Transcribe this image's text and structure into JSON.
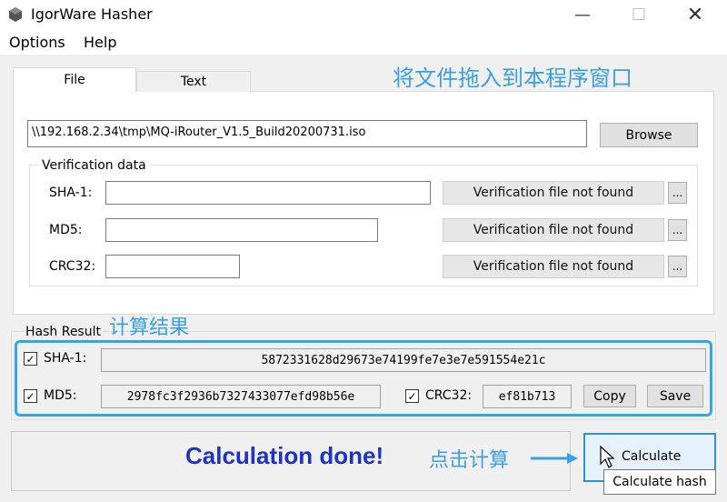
{
  "window": {
    "title": "IgorWare Hasher"
  },
  "menu": {
    "options": "Options",
    "help": "Help"
  },
  "tabs": {
    "file": "File",
    "text": "Text"
  },
  "annotations": {
    "drag_hint": "将文件拖入到本程序窗口",
    "result_hint": "计算结果",
    "click_hint": "点击计算"
  },
  "file": {
    "path": "\\\\192.168.2.34\\tmp\\MQ-iRouter_V1.5_Build20200731.iso",
    "browse_label": "Browse"
  },
  "verification": {
    "group_label": "Verification data",
    "rows": [
      {
        "label": "SHA-1:",
        "value": "",
        "status": "Verification file not found",
        "button": "..."
      },
      {
        "label": "MD5:",
        "value": "",
        "status": "Verification file not found",
        "button": "..."
      },
      {
        "label": "CRC32:",
        "value": "",
        "status": "Verification file not found",
        "button": "..."
      }
    ]
  },
  "hash_result": {
    "group_label": "Hash Result",
    "sha1": {
      "label": "SHA-1:",
      "checked": true,
      "value": "5872331628d29673e74199fe7e3e7e591554e21c"
    },
    "md5": {
      "label": "MD5:",
      "checked": true,
      "value": "2978fc3f2936b7327433077efd98b56e"
    },
    "crc32": {
      "label": "CRC32:",
      "checked": true,
      "value": "ef81b713"
    },
    "copy_label": "Copy",
    "save_label": "Save"
  },
  "status": {
    "message": "Calculation done!",
    "color": "#1e33c4"
  },
  "calculate": {
    "label": "Calculate",
    "tooltip": "Calculate hash"
  },
  "colors": {
    "annotation": "#3aa0e6",
    "highlight": "#31a7e6"
  }
}
